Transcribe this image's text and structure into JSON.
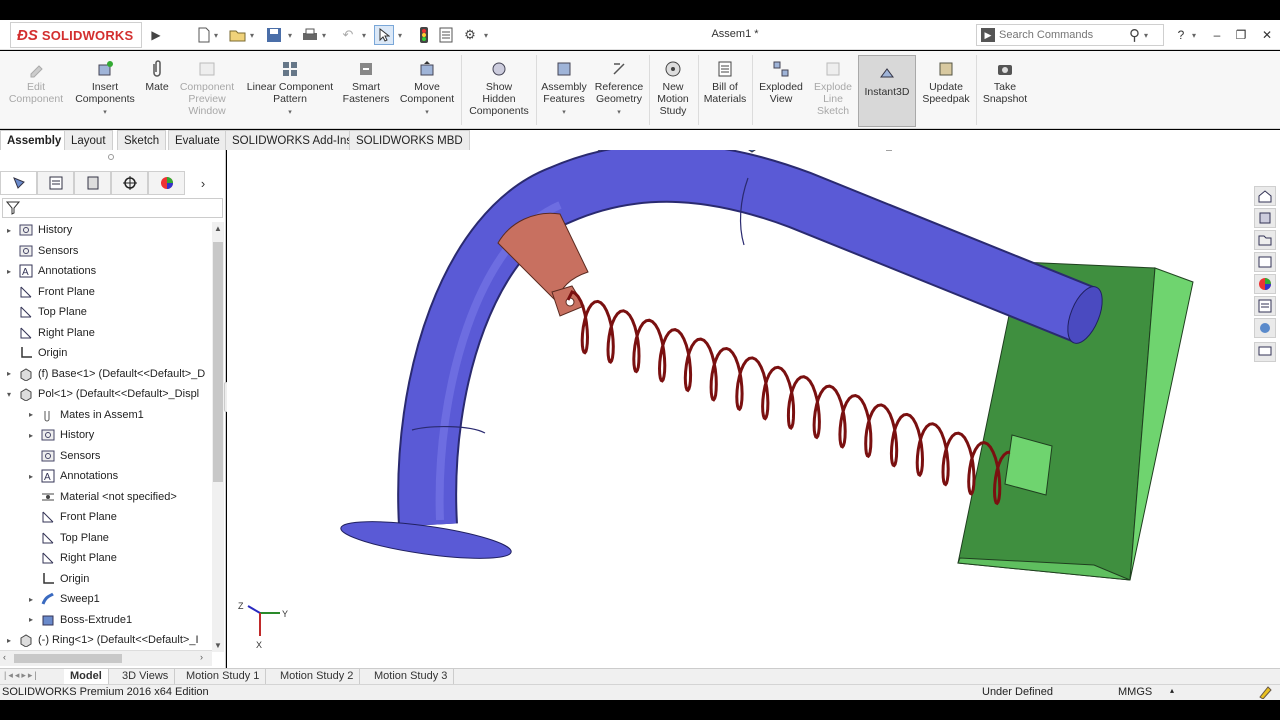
{
  "app": {
    "brand": "SOLIDWORKS",
    "doc_title": "Assem1 *"
  },
  "search": {
    "placeholder": "Search Commands"
  },
  "ribbon": {
    "items": [
      {
        "label1": "Edit",
        "label2": "Component",
        "label3": "",
        "disabled": true,
        "arrow": false
      },
      {
        "label1": "Insert",
        "label2": "Components",
        "label3": "",
        "disabled": false,
        "arrow": true
      },
      {
        "label1": "Mate",
        "label2": "",
        "label3": "",
        "disabled": false,
        "arrow": false
      },
      {
        "label1": "Component",
        "label2": "Preview",
        "label3": "Window",
        "disabled": true,
        "arrow": false
      },
      {
        "label1": "Linear Component",
        "label2": "Pattern",
        "label3": "",
        "disabled": false,
        "arrow": true
      },
      {
        "label1": "Smart",
        "label2": "Fasteners",
        "label3": "",
        "disabled": false,
        "arrow": false
      },
      {
        "label1": "Move",
        "label2": "Component",
        "label3": "",
        "disabled": false,
        "arrow": true
      },
      {
        "label1": "Show",
        "label2": "Hidden",
        "label3": "Components",
        "disabled": false,
        "arrow": false
      },
      {
        "label1": "Assembly",
        "label2": "Features",
        "label3": "",
        "disabled": false,
        "arrow": true
      },
      {
        "label1": "Reference",
        "label2": "Geometry",
        "label3": "",
        "disabled": false,
        "arrow": true
      },
      {
        "label1": "New",
        "label2": "Motion",
        "label3": "Study",
        "disabled": false,
        "arrow": false
      },
      {
        "label1": "Bill of",
        "label2": "Materials",
        "label3": "",
        "disabled": false,
        "arrow": false
      },
      {
        "label1": "Exploded",
        "label2": "View",
        "label3": "",
        "disabled": false,
        "arrow": false
      },
      {
        "label1": "Explode",
        "label2": "Line",
        "label3": "Sketch",
        "disabled": true,
        "arrow": false
      },
      {
        "label1": "Instant3D",
        "label2": "",
        "label3": "",
        "disabled": false,
        "arrow": false
      },
      {
        "label1": "Update",
        "label2": "Speedpak",
        "label3": "",
        "disabled": false,
        "arrow": false
      },
      {
        "label1": "Take",
        "label2": "Snapshot",
        "label3": "",
        "disabled": false,
        "arrow": false
      }
    ]
  },
  "tabs": [
    "Assembly",
    "Layout",
    "Sketch",
    "Evaluate",
    "SOLIDWORKS Add-Ins",
    "SOLIDWORKS MBD"
  ],
  "tree": [
    {
      "label": "History",
      "exp": "▸",
      "level": 0
    },
    {
      "label": "Sensors",
      "exp": "",
      "level": 0
    },
    {
      "label": "Annotations",
      "exp": "▸",
      "level": 0
    },
    {
      "label": "Front Plane",
      "exp": "",
      "level": 0
    },
    {
      "label": "Top Plane",
      "exp": "",
      "level": 0
    },
    {
      "label": "Right Plane",
      "exp": "",
      "level": 0
    },
    {
      "label": "Origin",
      "exp": "",
      "level": 0
    },
    {
      "label": "(f) Base<1> (Default<<Default>_D",
      "exp": "▸",
      "level": 0
    },
    {
      "label": "Pol<1> (Default<<Default>_Displ",
      "exp": "▾",
      "level": 0
    },
    {
      "label": "Mates in Assem1",
      "exp": "▸",
      "level": 1
    },
    {
      "label": "History",
      "exp": "▸",
      "level": 1
    },
    {
      "label": "Sensors",
      "exp": "",
      "level": 1
    },
    {
      "label": "Annotations",
      "exp": "▸",
      "level": 1
    },
    {
      "label": "Material <not specified>",
      "exp": "",
      "level": 1
    },
    {
      "label": "Front Plane",
      "exp": "",
      "level": 1
    },
    {
      "label": "Top Plane",
      "exp": "",
      "level": 1
    },
    {
      "label": "Right Plane",
      "exp": "",
      "level": 1
    },
    {
      "label": "Origin",
      "exp": "",
      "level": 1
    },
    {
      "label": "Sweep1",
      "exp": "▸",
      "level": 1
    },
    {
      "label": "Boss-Extrude1",
      "exp": "▸",
      "level": 1
    },
    {
      "label": "(-) Ring<1> (Default<<Default>_I",
      "exp": "▸",
      "level": 0
    }
  ],
  "bottom_tabs": [
    "Model",
    "3D Views",
    "Motion Study 1",
    "Motion Study 2",
    "Motion Study 3"
  ],
  "status": {
    "edition": "SOLIDWORKS Premium 2016 x64 Edition",
    "state": "Under Defined",
    "units": "MMGS"
  },
  "triad": {
    "z": "Z",
    "y": "Y",
    "x": "X"
  },
  "colors": {
    "pipe": "#5a5ad6",
    "ring": "#c87060",
    "spring": "#7a1010",
    "block": "#3f8f3f",
    "block_face": "#6fd46f"
  }
}
